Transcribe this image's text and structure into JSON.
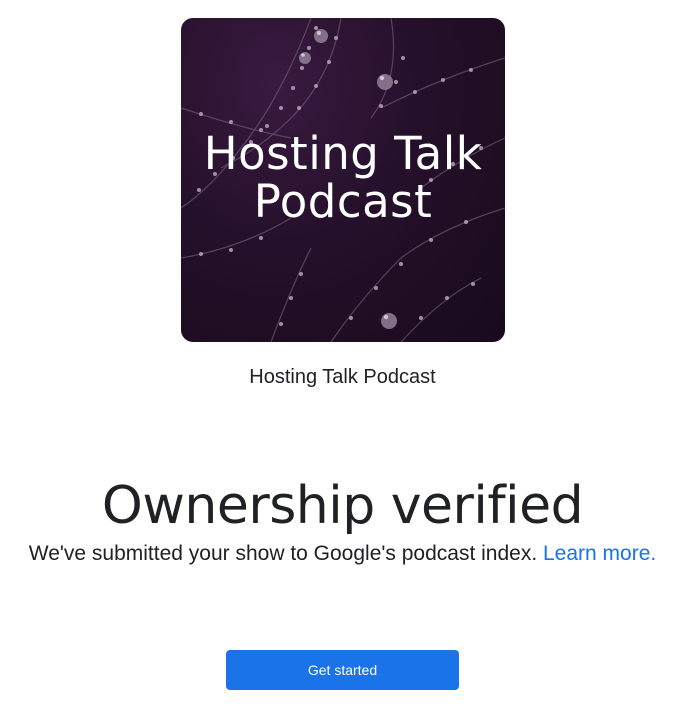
{
  "podcast": {
    "cover_title": "Hosting Talk\nPodcast",
    "name": "Hosting Talk Podcast"
  },
  "status": {
    "headline": "Ownership verified",
    "message": "We've submitted your show to Google's podcast index.",
    "learn_more_label": "Learn more."
  },
  "actions": {
    "get_started_label": "Get started"
  },
  "colors": {
    "accent": "#1a73e8",
    "cover_bg": "#24102a",
    "text": "#202124"
  }
}
